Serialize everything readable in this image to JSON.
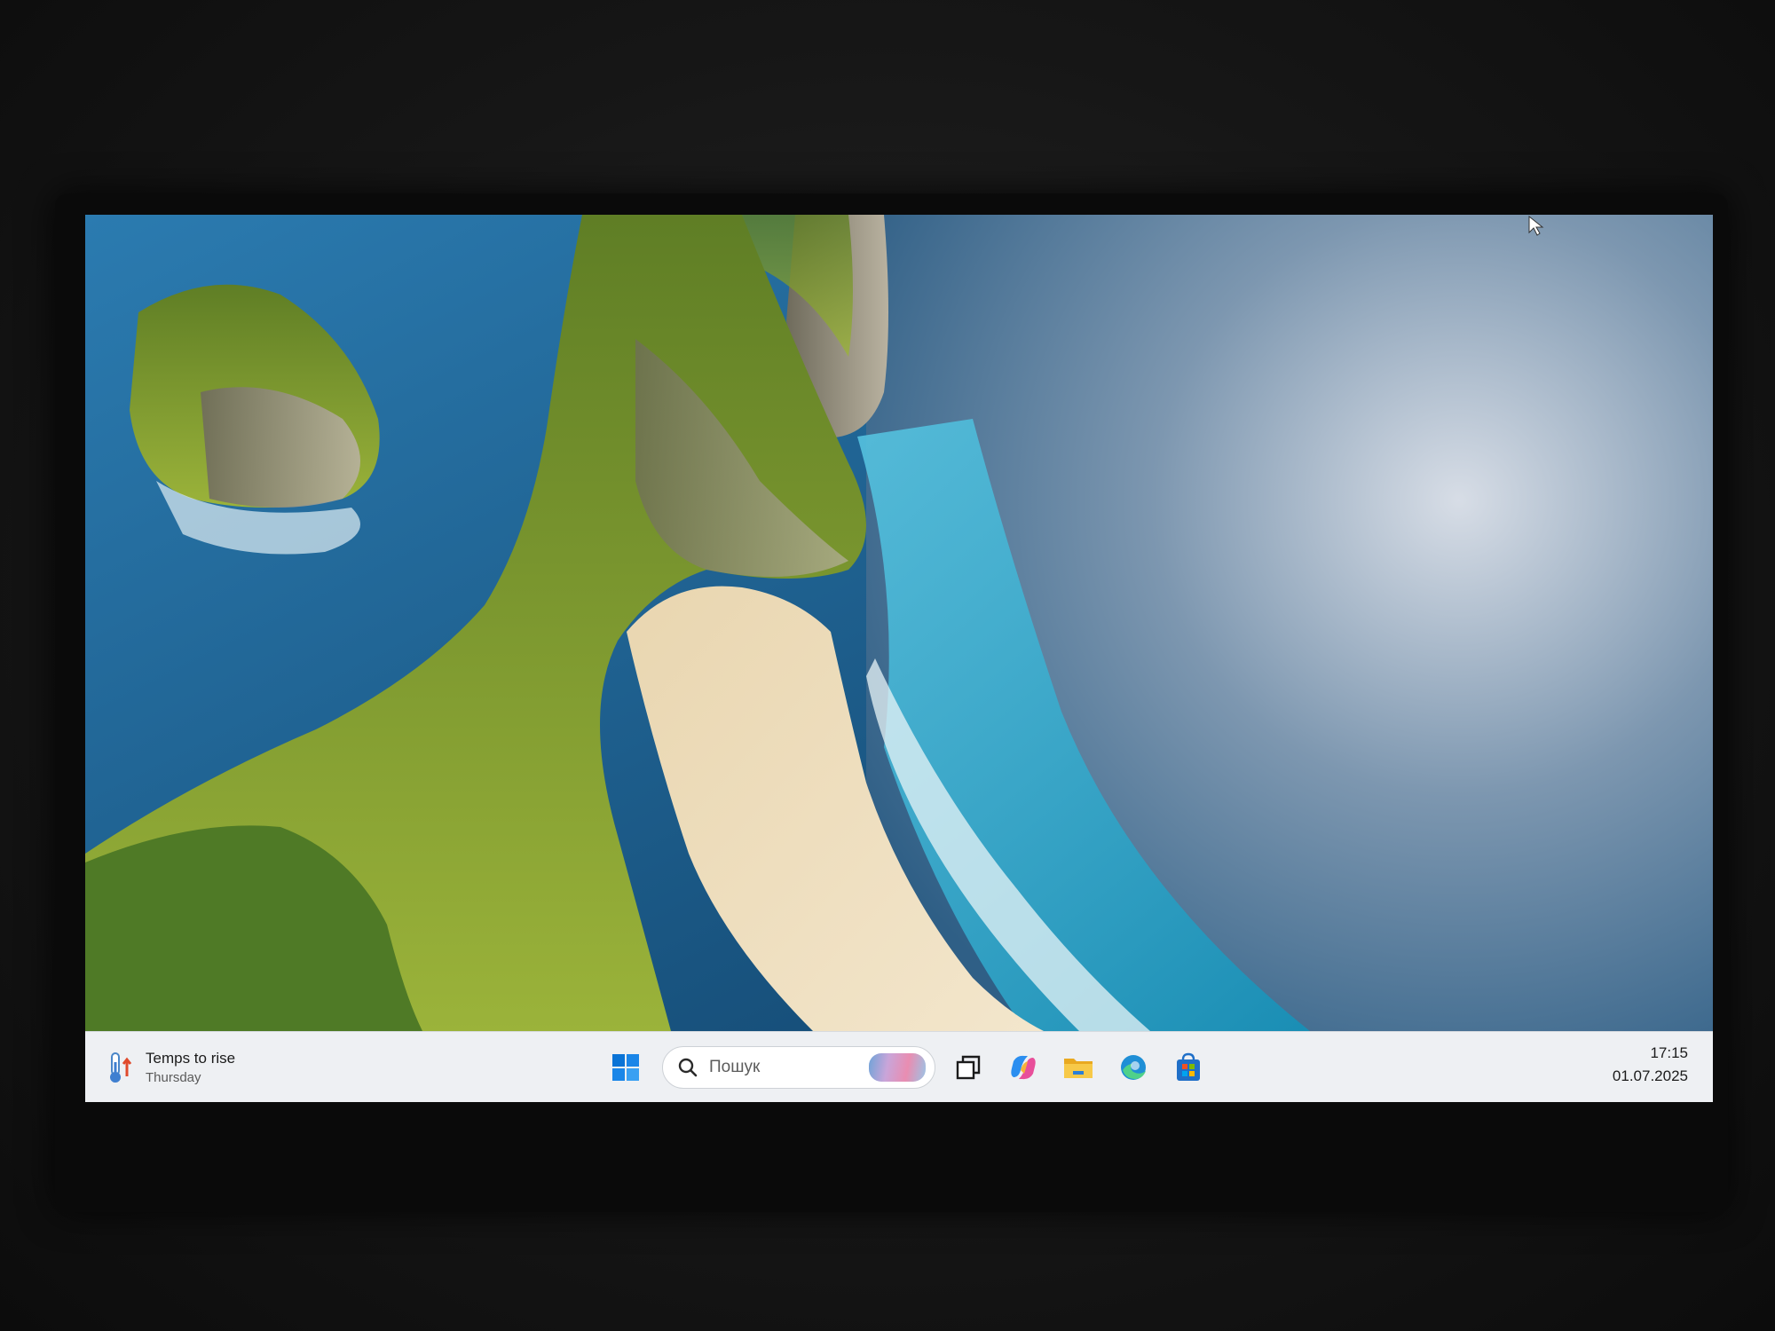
{
  "taskbar": {
    "widget": {
      "title": "Temps to rise",
      "subtitle": "Thursday"
    },
    "search": {
      "placeholder": "Пошук"
    },
    "apps": [
      {
        "name": "start",
        "icon": "windows-logo-icon"
      },
      {
        "name": "task-view",
        "icon": "task-view-icon"
      },
      {
        "name": "copilot",
        "icon": "copilot-icon"
      },
      {
        "name": "file-explorer",
        "icon": "folder-icon"
      },
      {
        "name": "edge",
        "icon": "edge-browser-icon"
      },
      {
        "name": "microsoft-store",
        "icon": "store-icon"
      }
    ],
    "clock": {
      "time": "17:15",
      "date": "01.07.2025"
    }
  },
  "colors": {
    "taskbar_bg": "#eef0f3",
    "accent_blue": "#0a74d6",
    "ocean": "#1b5f8a",
    "cliff_green": "#7a9a2c",
    "sand": "#e6cfa3"
  }
}
